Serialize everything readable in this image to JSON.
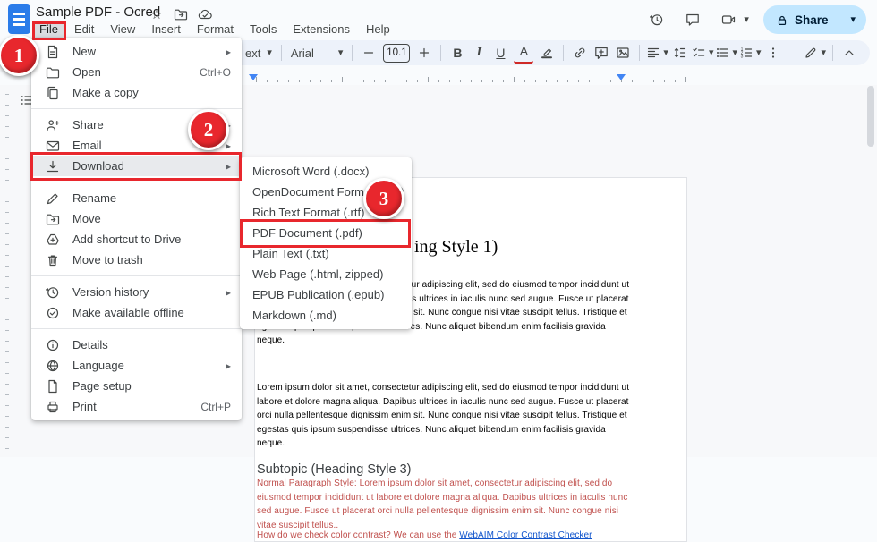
{
  "colors": {
    "annotation_red": "#e8272d",
    "share_bg": "#c2e7ff",
    "link_blue": "#1155cc",
    "doc_red_text": "#c0504d",
    "toolbar_bg": "#edf2fa",
    "logo_blue": "#2b7ce9"
  },
  "header": {
    "title": "Sample PDF - Ocred",
    "title_icons": [
      {
        "icon": "star",
        "name": "star-icon"
      },
      {
        "icon": "folder-move",
        "name": "move-folder-icon"
      },
      {
        "icon": "cloud",
        "name": "document-status-icon"
      }
    ],
    "menu": [
      {
        "label": "File",
        "active": true
      },
      {
        "label": "Edit"
      },
      {
        "label": "View"
      },
      {
        "label": "Insert"
      },
      {
        "label": "Format"
      },
      {
        "label": "Tools"
      },
      {
        "label": "Extensions"
      },
      {
        "label": "Help"
      }
    ],
    "right_icons": [
      {
        "icon": "history",
        "name": "version-history-icon"
      },
      {
        "icon": "comment",
        "name": "open-comments-icon"
      },
      {
        "icon": "videocam",
        "name": "meet-icon",
        "caret": true
      }
    ],
    "share_label": "Share"
  },
  "toolbar": {
    "font": "Arial",
    "font_size": "10.1",
    "styles_partial": "ext",
    "items": [
      {
        "t": "dd",
        "bind": "styles_partial",
        "name": "paragraph-styles-dropdown"
      },
      {
        "t": "sep"
      },
      {
        "t": "dd",
        "bind": "font",
        "name": "font-family-dropdown",
        "wide": true
      },
      {
        "t": "sep"
      },
      {
        "t": "btn",
        "icon": "minus",
        "name": "decrease-font-size-button"
      },
      {
        "t": "sizebox",
        "name": "font-size-input"
      },
      {
        "t": "btn",
        "icon": "plus",
        "name": "increase-font-size-button"
      },
      {
        "t": "sep"
      },
      {
        "t": "text",
        "label": "B",
        "cls": "b",
        "name": "bold-button"
      },
      {
        "t": "text",
        "label": "I",
        "cls": "i",
        "name": "italic-button"
      },
      {
        "t": "text",
        "label": "U",
        "cls": "u",
        "name": "underline-button"
      },
      {
        "t": "text",
        "label": "A",
        "cls": "a",
        "name": "text-color-button"
      },
      {
        "t": "btn",
        "icon": "highlighter",
        "name": "highlight-color-button"
      },
      {
        "t": "sep"
      },
      {
        "t": "btn",
        "icon": "link",
        "name": "insert-link-button"
      },
      {
        "t": "btn",
        "icon": "comment-add",
        "name": "add-comment-button"
      },
      {
        "t": "btn",
        "icon": "image",
        "name": "insert-image-button"
      },
      {
        "t": "sep"
      },
      {
        "t": "btncaret",
        "icon": "align-left",
        "name": "align-button"
      },
      {
        "t": "btn",
        "icon": "line-spacing",
        "name": "line-spacing-button"
      },
      {
        "t": "btncaret",
        "icon": "checklist",
        "name": "checklist-button"
      },
      {
        "t": "btncaret",
        "icon": "bullets",
        "name": "bulleted-list-button"
      },
      {
        "t": "btncaret",
        "icon": "numbers",
        "name": "numbered-list-button"
      },
      {
        "t": "btn",
        "icon": "dots-vertical",
        "name": "more-options-button"
      },
      {
        "t": "gap"
      },
      {
        "t": "btncaret",
        "icon": "pen",
        "name": "editing-mode-button"
      },
      {
        "t": "sep"
      },
      {
        "t": "btn",
        "icon": "chevron-up",
        "name": "hide-menus-button",
        "pad": true
      }
    ]
  },
  "file_menu": {
    "sections": [
      [
        {
          "icon": "doc-new",
          "label": "New",
          "arrow": true
        },
        {
          "icon": "folder",
          "label": "Open",
          "shortcut": "Ctrl+O"
        },
        {
          "icon": "copy",
          "label": "Make a copy"
        }
      ],
      [
        {
          "icon": "person-add",
          "label": "Share",
          "arrow": true
        },
        {
          "icon": "mail",
          "label": "Email",
          "arrow": true
        },
        {
          "icon": "download",
          "label": "Download",
          "arrow": true,
          "highlight": true
        }
      ],
      [
        {
          "icon": "pencil",
          "label": "Rename"
        },
        {
          "icon": "folder-move",
          "label": "Move"
        },
        {
          "icon": "drive-add",
          "label": "Add shortcut to Drive"
        },
        {
          "icon": "trash",
          "label": "Move to trash"
        }
      ],
      [
        {
          "icon": "history",
          "label": "Version history",
          "arrow": true
        },
        {
          "icon": "offline",
          "label": "Make available offline"
        }
      ],
      [
        {
          "icon": "info",
          "label": "Details"
        },
        {
          "icon": "globe",
          "label": "Language",
          "arrow": true
        },
        {
          "icon": "page",
          "label": "Page setup"
        },
        {
          "icon": "printer",
          "label": "Print",
          "shortcut": "Ctrl+P"
        }
      ]
    ]
  },
  "download_menu": {
    "items": [
      {
        "label": "Microsoft Word (.docx)"
      },
      {
        "label": "OpenDocument Format (.odt)"
      },
      {
        "label": "Rich Text Format (.rtf)"
      },
      {
        "label": "PDF Document (.pdf)",
        "boxed": true
      },
      {
        "label": "Plain Text (.txt)"
      },
      {
        "label": "Web Page (.html, zipped)"
      },
      {
        "label": "EPUB Publication (.epub)"
      },
      {
        "label": "Markdown (.md)"
      }
    ]
  },
  "document": {
    "heading1_visible": "ing Style 1)",
    "paragraph1": "Lorem ipsum dolor sit amet, consectetur adipiscing elit, sed do eiusmod tempor incididunt ut labore et dolore magna aliqua. Dapibus ultrices in iaculis nunc sed augue. Fusce ut placerat orci nulla pellentesque dignissim enim sit. Nunc congue nisi vitae suscipit tellus. Tristique et egestas quis ipsum suspendisse ultrices. Nunc aliquet bibendum enim facilisis gravida neque.",
    "paragraph2": "Lorem ipsum dolor sit amet, consectetur adipiscing elit, sed do eiusmod tempor incididunt ut labore et dolore magna aliqua. Dapibus ultrices in iaculis nunc sed augue. Fusce ut placerat orci nulla pellentesque dignissim enim sit. Nunc congue nisi vitae suscipit tellus. Tristique et egestas quis ipsum suspendisse ultrices. Nunc aliquet bibendum enim facilisis gravida neque.",
    "heading3": "Subtopic (Heading Style 3)",
    "red_paragraph": "Normal Paragraph Style: Lorem ipsum dolor sit amet, consectetur adipiscing elit, sed do eiusmod tempor incididunt ut labore et dolore magna aliqua. Dapibus ultrices in iaculis nunc sed augue. Fusce ut placerat orci nulla pellentesque dignissim enim sit. Nunc congue nisi vitae suscipit tellus..",
    "question_prefix": "How do we check color contrast? We can use the ",
    "question_link": "WebAIM Color Contrast Checker"
  },
  "annotations": {
    "steps": [
      "1",
      "2",
      "3"
    ]
  }
}
